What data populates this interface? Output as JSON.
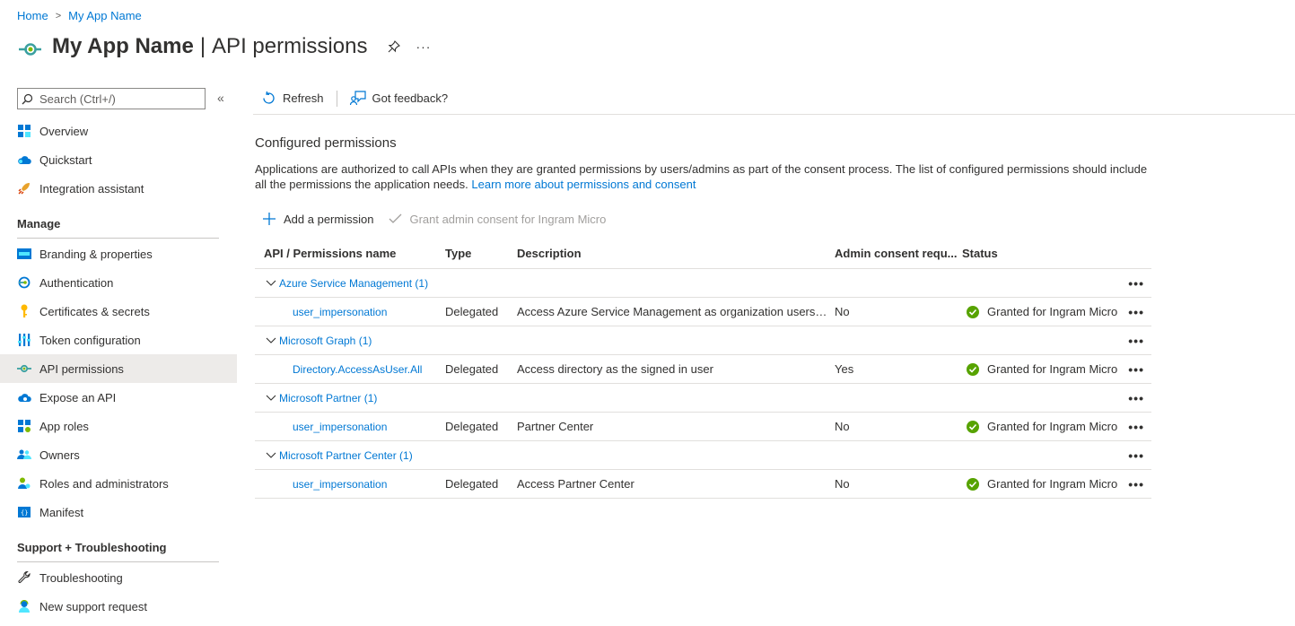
{
  "breadcrumb": {
    "home": "Home",
    "app": "My App Name"
  },
  "header": {
    "app_name": "My App Name",
    "separator": "|",
    "page": "API permissions",
    "more": "···"
  },
  "sidebar": {
    "search_placeholder": "Search (Ctrl+/)",
    "collapse": "«",
    "items_top": [
      {
        "label": "Overview"
      },
      {
        "label": "Quickstart"
      },
      {
        "label": "Integration assistant"
      }
    ],
    "manage_heading": "Manage",
    "items_manage": [
      {
        "label": "Branding & properties"
      },
      {
        "label": "Authentication"
      },
      {
        "label": "Certificates & secrets"
      },
      {
        "label": "Token configuration"
      },
      {
        "label": "API permissions"
      },
      {
        "label": "Expose an API"
      },
      {
        "label": "App roles"
      },
      {
        "label": "Owners"
      },
      {
        "label": "Roles and administrators"
      },
      {
        "label": "Manifest"
      }
    ],
    "support_heading": "Support + Troubleshooting",
    "items_support": [
      {
        "label": "Troubleshooting"
      },
      {
        "label": "New support request"
      }
    ]
  },
  "toolbar": {
    "refresh": "Refresh",
    "feedback": "Got feedback?"
  },
  "main": {
    "title": "Configured permissions",
    "desc_text": "Applications are authorized to call APIs when they are granted permissions by users/admins as part of the consent process. The list of configured permissions should include all the permissions the application needs.",
    "desc_link": "Learn more about permissions and consent",
    "add_permission": "Add a permission",
    "grant_consent": "Grant admin consent for Ingram Micro"
  },
  "table": {
    "headers": [
      "API / Permissions name",
      "Type",
      "Description",
      "Admin consent requ...",
      "Status"
    ],
    "groups": [
      {
        "name": "Azure Service Management (1)",
        "perm": {
          "name": "user_impersonation",
          "type": "Delegated",
          "desc": "Access Azure Service Management as organization users (...",
          "admin": "No",
          "status": "Granted for Ingram Micro"
        }
      },
      {
        "name": "Microsoft Graph (1)",
        "perm": {
          "name": "Directory.AccessAsUser.All",
          "type": "Delegated",
          "desc": "Access directory as the signed in user",
          "admin": "Yes",
          "status": "Granted for Ingram Micro"
        }
      },
      {
        "name": "Microsoft Partner (1)",
        "perm": {
          "name": "user_impersonation",
          "type": "Delegated",
          "desc": "Partner Center",
          "admin": "No",
          "status": "Granted for Ingram Micro"
        }
      },
      {
        "name": "Microsoft Partner Center (1)",
        "perm": {
          "name": "user_impersonation",
          "type": "Delegated",
          "desc": "Access Partner Center",
          "admin": "No",
          "status": "Granted for Ingram Micro"
        }
      }
    ],
    "row_more": "•••"
  },
  "colors": {
    "accent": "#0078d4",
    "success": "#57a300",
    "text": "#323130",
    "active_bg": "#edebe9"
  }
}
